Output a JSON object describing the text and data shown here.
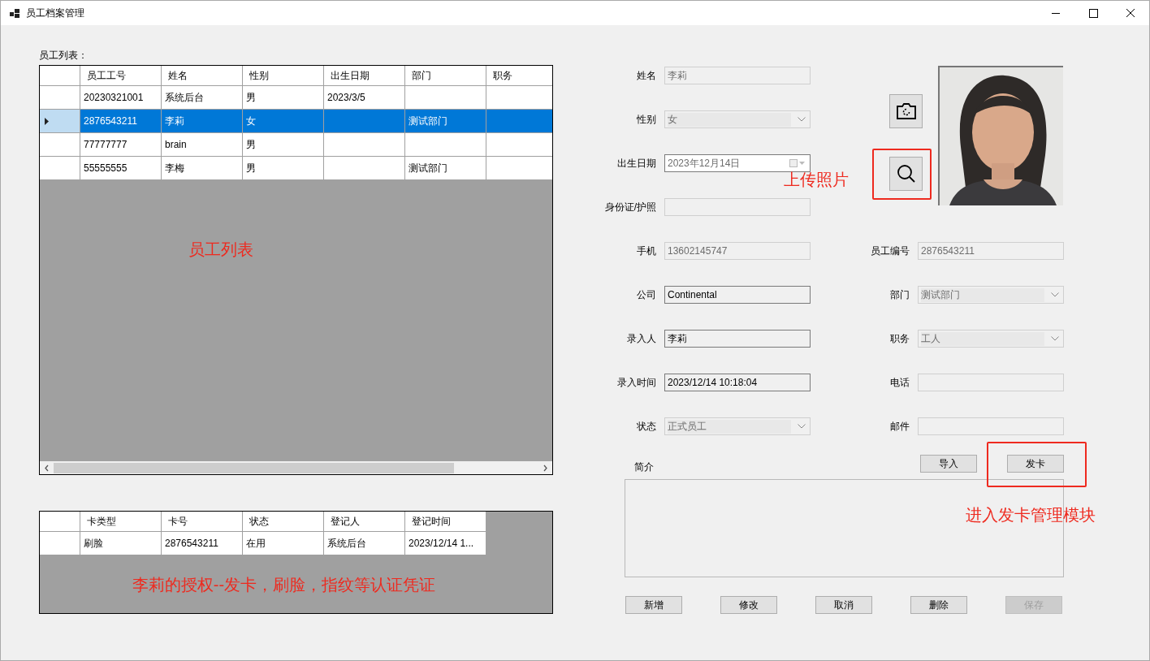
{
  "window": {
    "title": "员工档案管理"
  },
  "employee_list": {
    "label": "员工列表：",
    "annotation": "员工列表",
    "columns": [
      "员工工号",
      "姓名",
      "性别",
      "出生日期",
      "部门",
      "职务"
    ],
    "rows": [
      {
        "cells": [
          "20230321001",
          "系统后台",
          "男",
          "2023/3/5",
          "",
          ""
        ],
        "selected": false
      },
      {
        "cells": [
          "2876543211",
          "李莉",
          "女",
          "",
          "测试部门",
          ""
        ],
        "selected": true
      },
      {
        "cells": [
          "77777777",
          "brain",
          "男",
          "",
          "",
          ""
        ],
        "selected": false
      },
      {
        "cells": [
          "55555555",
          "李梅",
          "男",
          "",
          "测试部门",
          ""
        ],
        "selected": false
      }
    ]
  },
  "cards": {
    "annotation": "李莉的授权--发卡，刷脸，指纹等认证凭证",
    "columns": [
      "卡类型",
      "卡号",
      "状态",
      "登记人",
      "登记时间"
    ],
    "rows": [
      {
        "cells": [
          "刷脸",
          "2876543211",
          "在用",
          "系统后台",
          "2023/12/14 1..."
        ]
      }
    ]
  },
  "form": {
    "photo_note": "上传照片",
    "card_note": "进入发卡管理模块",
    "left": [
      {
        "label": "姓名",
        "kind": "text",
        "value": "李莉",
        "disabled": true
      },
      {
        "label": "性别",
        "kind": "combo",
        "value": "女",
        "disabled": true
      },
      {
        "label": "出生日期",
        "kind": "date",
        "value": "2023年12月14日",
        "disabled": false
      },
      {
        "label": "身份证/护照",
        "kind": "text",
        "disabled": true
      },
      {
        "label": "手机",
        "kind": "text",
        "value": "13602145747",
        "disabled": true
      },
      {
        "label": "公司",
        "kind": "text",
        "value": "Continental",
        "disabled": false
      },
      {
        "label": "录入人",
        "kind": "text",
        "value": "李莉",
        "disabled": false
      },
      {
        "label": "录入时间",
        "kind": "text",
        "value": "2023/12/14 10:18:04",
        "disabled": false
      },
      {
        "label": "状态",
        "kind": "combo",
        "value": "正式员工",
        "disabled": true
      }
    ],
    "right": [
      {
        "label": "员工编号",
        "kind": "text",
        "value": "2876543211",
        "disabled": true
      },
      {
        "label": "部门",
        "kind": "combo",
        "value": "测试部门",
        "disabled": true
      },
      {
        "label": "职务",
        "kind": "combo",
        "value": "工人",
        "disabled": true
      },
      {
        "label": "电话",
        "kind": "text",
        "disabled": true
      },
      {
        "label": "邮件",
        "kind": "text",
        "disabled": true
      }
    ],
    "actions": [
      {
        "label": "导入",
        "disabled": false
      },
      {
        "label": "发卡",
        "disabled": false
      }
    ],
    "intro": {
      "label": "简介"
    },
    "buttons": [
      {
        "label": "新增",
        "disabled": false
      },
      {
        "label": "修改",
        "disabled": false
      },
      {
        "label": "取消",
        "disabled": false
      },
      {
        "label": "删除",
        "disabled": false
      },
      {
        "label": "保存",
        "disabled": true
      }
    ]
  }
}
